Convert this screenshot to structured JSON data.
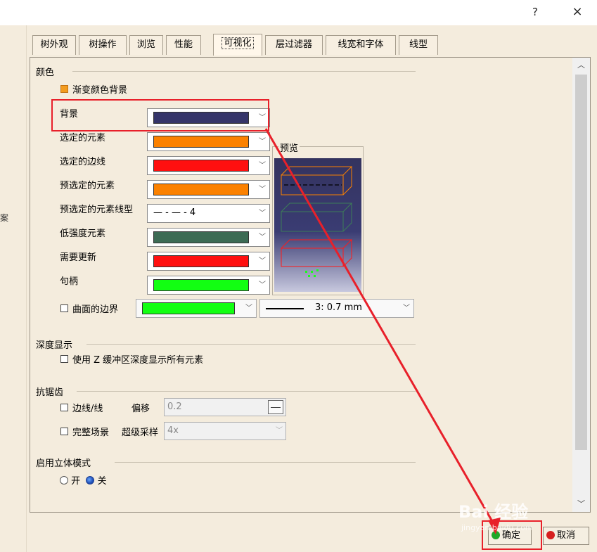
{
  "window": {
    "help_label": "?",
    "close_label": "×"
  },
  "left_glyph": "案",
  "tabs": [
    {
      "label": "树外观"
    },
    {
      "label": "树操作"
    },
    {
      "label": "浏览"
    },
    {
      "label": "性能"
    },
    {
      "label": "可视化"
    },
    {
      "label": "层过滤器"
    },
    {
      "label": "线宽和字体"
    },
    {
      "label": "线型"
    }
  ],
  "active_tab": "可视化",
  "color_section": {
    "title": "颜色",
    "gradient_label": "渐变颜色背景",
    "gradient_checked": true,
    "rows": [
      {
        "label": "背景",
        "color": "#35356a"
      },
      {
        "label": "选定的元素",
        "color": "#fb8100"
      },
      {
        "label": "选定的边线",
        "color": "#ff0f0f"
      },
      {
        "label": "预选定的元素",
        "color": "#fb8100"
      },
      {
        "label": "预选定的元素线型",
        "linetype": "— - — -  4"
      },
      {
        "label": "低强度元素",
        "color": "#3d6b54"
      },
      {
        "label": "需要更新",
        "color": "#ff0f0f"
      },
      {
        "label": "句柄",
        "color": "#12ff12"
      }
    ],
    "surface_boundary_label": "曲面的边界",
    "surface_boundary_color": "#12ff12",
    "surface_boundary_linewidth": "3: 0.7 mm",
    "preview_label": "预览"
  },
  "depth_section": {
    "title": "深度显示",
    "checkbox_label": "使用 Z 缓冲区深度显示所有元素"
  },
  "aa_section": {
    "title": "抗锯齿",
    "edge_label": "边线/线",
    "offset_label": "偏移",
    "offset_value": "0.2",
    "scene_label": "完整场景",
    "supersample_label": "超级采样",
    "supersample_value": "4x"
  },
  "stereo_section": {
    "title": "启用立体模式",
    "on_label": "开",
    "off_label": "关",
    "selected": "关"
  },
  "buttons": {
    "ok_label": "确定",
    "cancel_label": "取消"
  },
  "watermark": {
    "brand": "Bai 经验",
    "url": "jingyan.baidu.com"
  },
  "colors": {
    "annotation_red": "#e8202a",
    "ok_dot": "#1fa827",
    "cancel_dot": "#d62020"
  }
}
